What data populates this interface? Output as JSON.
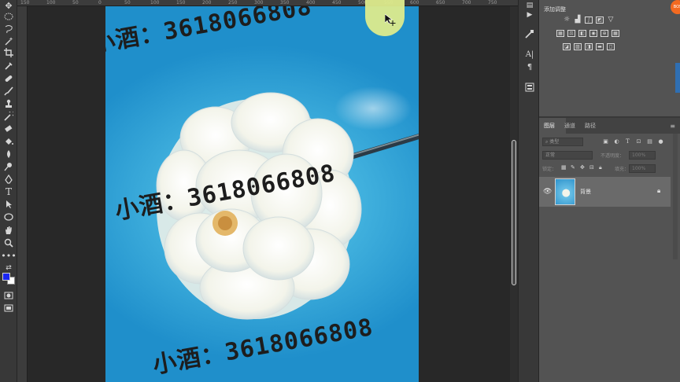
{
  "ruler": {
    "labels": [
      "150",
      "100",
      "50",
      "0",
      "50",
      "100",
      "150",
      "200",
      "250",
      "300",
      "350",
      "400",
      "450",
      "500",
      "550",
      "600",
      "650",
      "700",
      "750"
    ]
  },
  "canvas": {
    "watermarks": [
      "小酒：3618066808",
      "小酒：3618066808",
      "小酒：3618066808"
    ]
  },
  "colors": {
    "foreground": "#1a26f2",
    "background": "#ffffff"
  },
  "adjustments": {
    "title": "添加调整"
  },
  "layers_panel": {
    "tabs": [
      "图层",
      "通道",
      "路径"
    ],
    "filter_placeholder": "类型",
    "blend_mode": "正常",
    "opacity_label": "不透明度：",
    "opacity_value": "100%",
    "lock_label": "锁定：",
    "fill_label": "填充：",
    "fill_value": "100%",
    "layers": [
      {
        "name": "背景",
        "visible": true,
        "locked": true
      }
    ]
  },
  "badge": "BOS"
}
